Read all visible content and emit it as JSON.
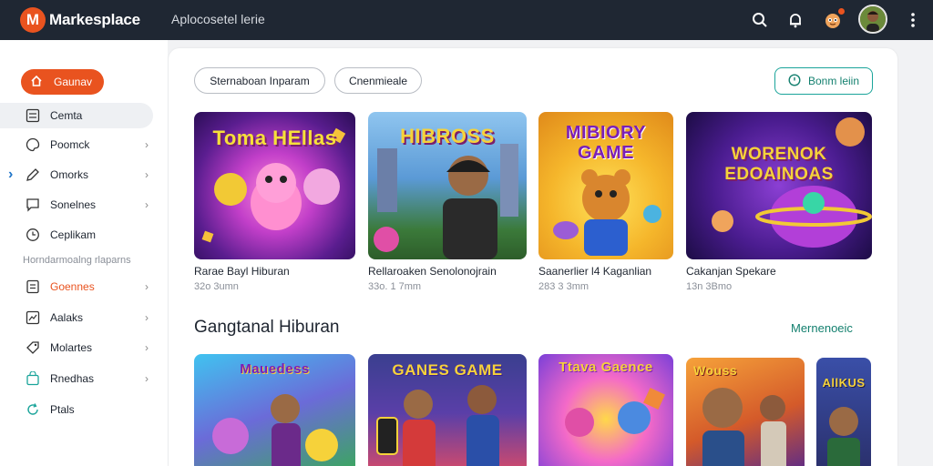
{
  "topbar": {
    "brand_letter": "M",
    "brand": "Markesplace",
    "search_text": "Aplocosetel lerie"
  },
  "sidebar": {
    "primary_label": "Gaunav",
    "items": [
      {
        "label": "Cemta"
      },
      {
        "label": "Poomck"
      },
      {
        "label": "Omorks"
      },
      {
        "label": "Sonelnes"
      },
      {
        "label": "Ceplikam"
      }
    ],
    "section_label": "Horndarmoalng rlaparns",
    "items2": [
      {
        "label": "Goennes"
      },
      {
        "label": "Aalaks"
      },
      {
        "label": "Molartes"
      },
      {
        "label": "Rnedhas"
      },
      {
        "label": "Ptals"
      }
    ]
  },
  "main": {
    "chips": [
      "Sternaboan Inparam",
      "Cnenmieale"
    ],
    "action_label": "Bonm leiin",
    "row1": [
      {
        "art_title": "Toma HEllas",
        "title": "Rarae Bayl Hiburan",
        "meta": "32o 3umn"
      },
      {
        "art_title": "HIBROSS",
        "title": "Rellaroaken Senolonojrain",
        "meta": "33o. 1 7mm"
      },
      {
        "art_title": "MIBIORY GAME",
        "title": "Saanerlier l4 Kaganlian",
        "meta": "283 3 3mm"
      },
      {
        "art_title": "WORENOK EDOAINOAS",
        "title": "Cakanjan Spekare",
        "meta": "13n 3Bmo"
      }
    ],
    "section_title": "Gangtanal Hiburan",
    "see_more": "Mernenoeic",
    "row2": [
      {
        "art_title": "Mauedess"
      },
      {
        "art_title": "GANES GAME"
      },
      {
        "art_title": "Ttava Gaence"
      },
      {
        "art_title": "Wouss"
      },
      {
        "art_title": "AllKUS"
      }
    ]
  },
  "colors": {
    "topbar": "#1f2733",
    "accent": "#e9531f",
    "teal": "#14806f"
  }
}
